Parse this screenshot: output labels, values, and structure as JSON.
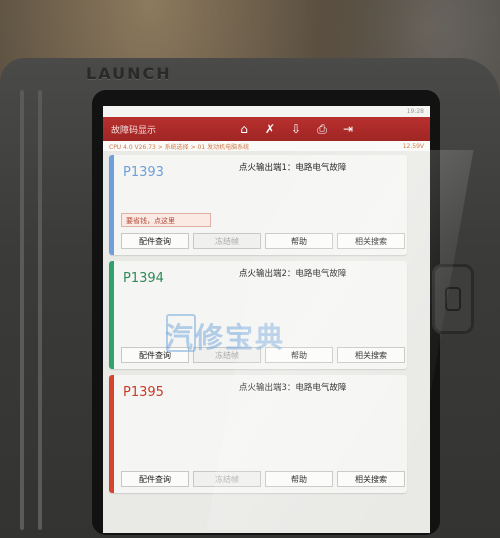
{
  "device": {
    "brand": "LAUNCH"
  },
  "statusbar": {
    "left": "",
    "time": "19:28"
  },
  "topbar": {
    "title": "故障码显示",
    "icons": [
      "home-icon",
      "tools-icon",
      "download-icon",
      "print-icon",
      "exit-icon"
    ]
  },
  "infobar": {
    "left": "CPU 4.0 V26.73 > 系统选择 > 01 发动机电脑系统",
    "right": "12.59V"
  },
  "buttons": {
    "parts": "配件查询",
    "freeze": "冻结帧",
    "help": "帮助",
    "search": "相关搜索"
  },
  "cards": [
    {
      "code": "P1393",
      "desc": "点火输出端1：电路电气故障",
      "tip": "要省钱，点这里",
      "color": "#6f9fd8"
    },
    {
      "code": "P1394",
      "desc": "点火输出端2：电路电气故障",
      "tip": "",
      "color": "#2fa36b"
    },
    {
      "code": "P1395",
      "desc": "点火输出端3：电路电气故障",
      "tip": "",
      "color": "#d6432f"
    }
  ],
  "watermark": {
    "text": "汽修宝典",
    "badge": "汽修"
  }
}
